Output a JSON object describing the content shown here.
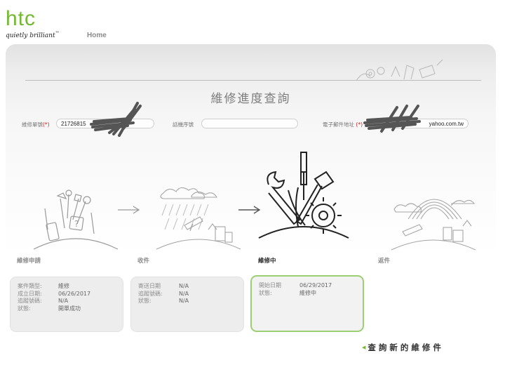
{
  "header": {
    "brand": "htc",
    "tagline": "quietly brilliant",
    "tagline_mark": "™",
    "home_label": "Home",
    "brand_color": "#73b832"
  },
  "main": {
    "title": "維修進度查詢",
    "form": {
      "repair_no": {
        "label": "維修單號",
        "required_mark": "(*)",
        "value": "21726815"
      },
      "serial_no": {
        "label": "話機序號",
        "value": ""
      },
      "email": {
        "label": "電子郵件地址",
        "required_mark": "(*)",
        "value": "yahoo.com.tw"
      }
    },
    "steps": [
      {
        "title": "維修申請",
        "active": false,
        "icon": "repair-request-illustration",
        "rows": [
          {
            "key": "案件類型:",
            "value": "維修"
          },
          {
            "key": "成立日期:",
            "value": "06/26/2017"
          },
          {
            "key": "追蹤號碼:",
            "value": "N/A"
          },
          {
            "key": "狀態:",
            "value": "開單成功"
          }
        ]
      },
      {
        "title": "收件",
        "active": false,
        "icon": "shipping-rain-illustration",
        "rows": [
          {
            "key": "寄送日期",
            "value": "N/A"
          },
          {
            "key": "追蹤號碼:",
            "value": "N/A"
          },
          {
            "key": "狀態:",
            "value": "N/A"
          }
        ]
      },
      {
        "title": "維修中",
        "active": true,
        "icon": "tools-repair-illustration",
        "rows": [
          {
            "key": "開始日期",
            "value": "06/29/2017"
          },
          {
            "key": "狀態:",
            "value": "維修中"
          }
        ]
      },
      {
        "title": "返件",
        "active": false,
        "icon": "return-rainbow-illustration"
      }
    ],
    "new_query_label": "查詢新的維修件",
    "active_border_color": "#9ccf74"
  }
}
